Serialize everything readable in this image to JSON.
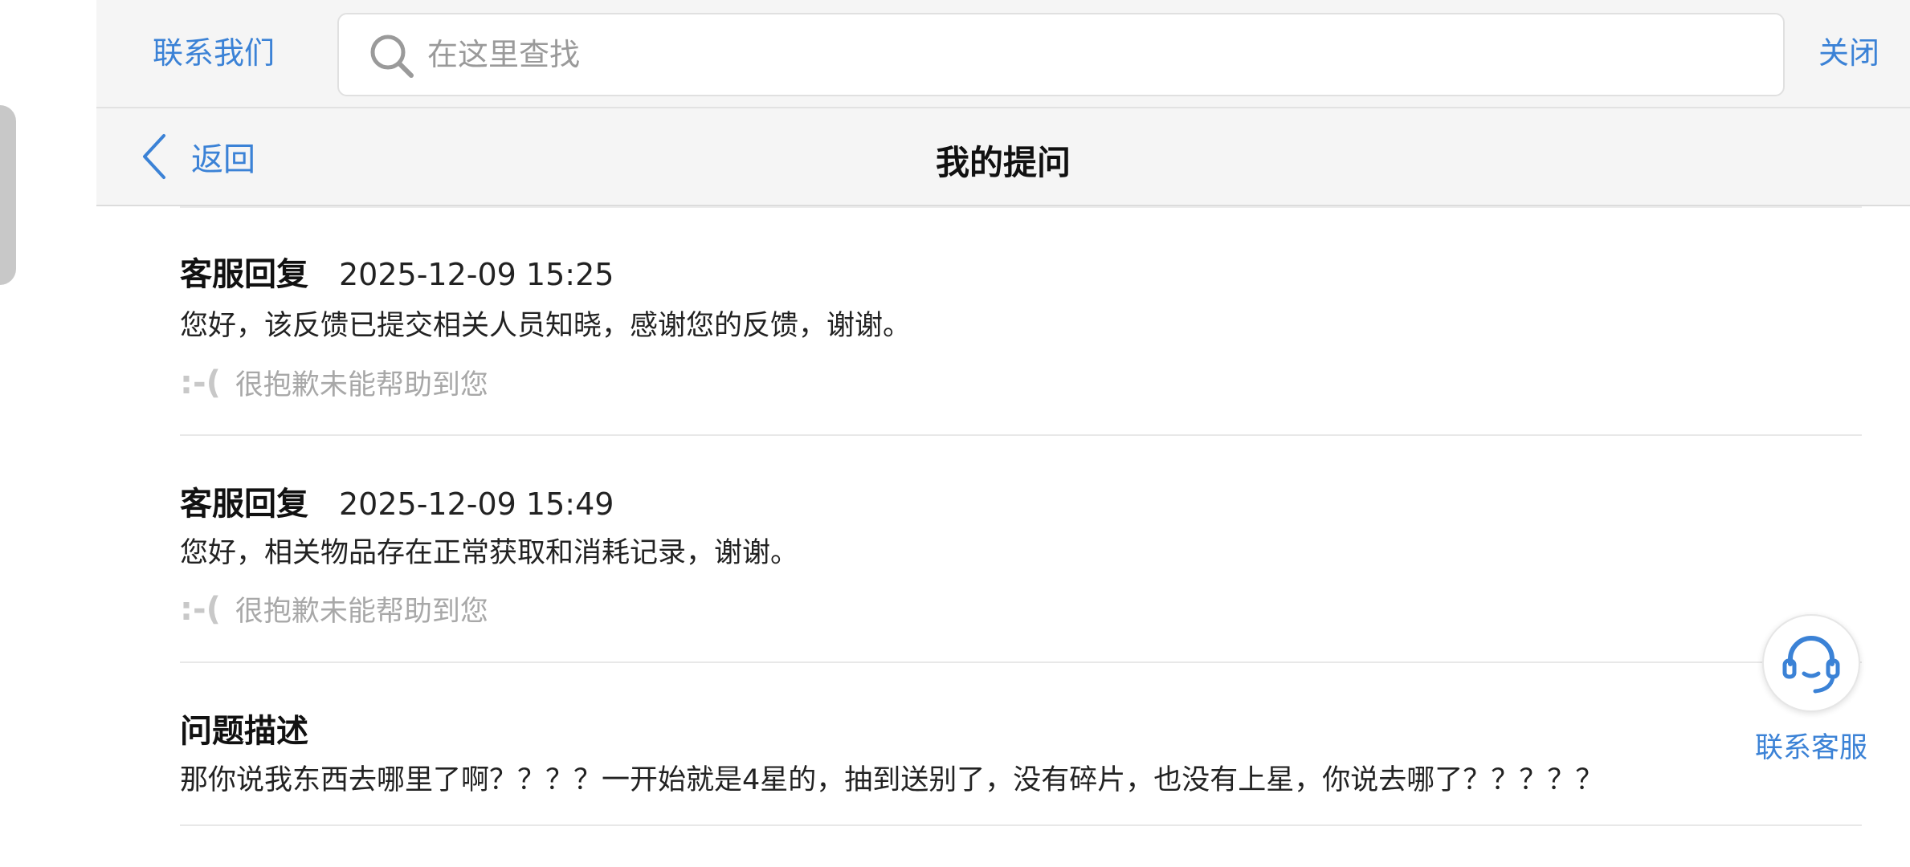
{
  "header": {
    "contact_label": "联系我们",
    "search_placeholder": "在这里查找",
    "close_label": "关闭"
  },
  "nav": {
    "back_label": "返回",
    "title": "我的提问"
  },
  "entries": [
    {
      "label": "客服回复",
      "time": "2025-12-09 15:25",
      "body": "您好，该反馈已提交相关人员知晓，感谢您的反馈，谢谢。",
      "feedback_icon": ":-(",
      "feedback_text": "很抱歉未能帮助到您"
    },
    {
      "label": "客服回复",
      "time": "2025-12-09 15:49",
      "body": "您好，相关物品存在正常获取和消耗记录，谢谢。",
      "feedback_icon": ":-(",
      "feedback_text": "很抱歉未能帮助到您"
    },
    {
      "label": "问题描述",
      "body": "那你说我东西去哪里了啊？？？？一开始就是4星的，抽到送别了，没有碎片，也没有上星，你说去哪了？？？？？"
    }
  ],
  "floating": {
    "label": "联系客服",
    "icon": "headset-icon"
  },
  "colors": {
    "accent": "#3b82d6",
    "header_bg": "#f5f5f5",
    "muted_text": "#a8a8a8"
  }
}
